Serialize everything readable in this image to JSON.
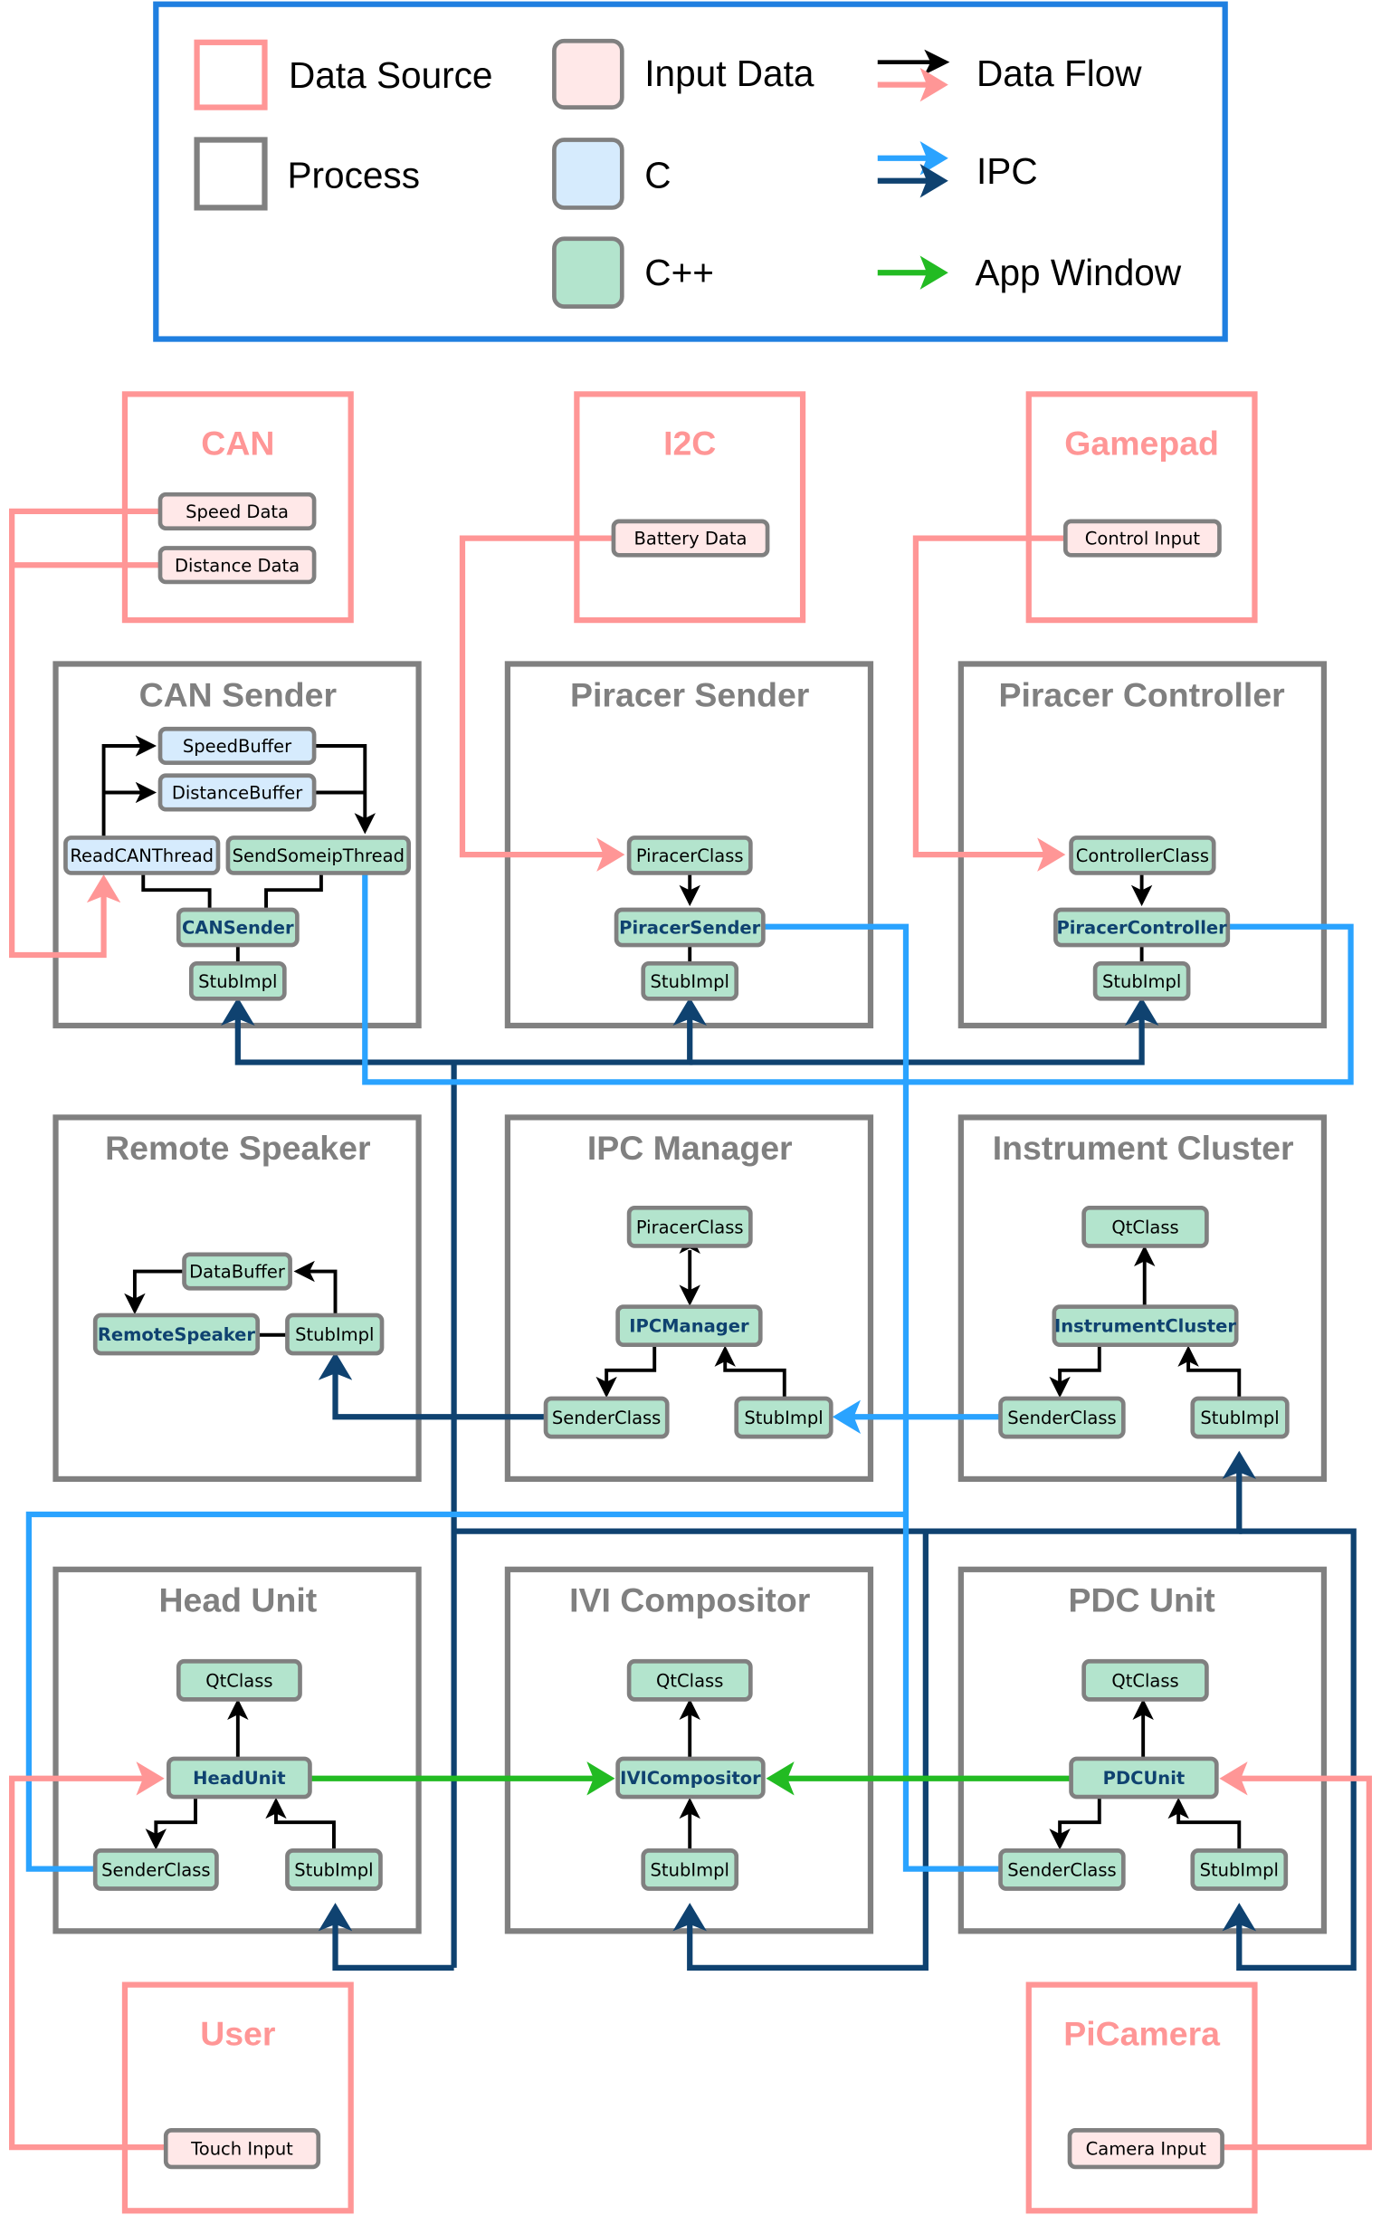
{
  "colors": {
    "data_source": "#ff9696",
    "process": "#808080",
    "input_data_fill": "#ffe8e8",
    "c_fill": "#d6ebfd",
    "cpp_fill": "#b3e4cd",
    "node_border": "#808080",
    "data_flow": "#000000",
    "data_flow_source": "#ff9696",
    "ipc_light": "#2aa3ff",
    "ipc_dark": "#0f4270",
    "app_window": "#22bb22",
    "legend_border": "#1f7fe0",
    "main_node_text": "#0f4270"
  },
  "legend": {
    "data_source": "Data Source",
    "process": "Process",
    "input_data": "Input Data",
    "c": "C",
    "cpp": "C++",
    "data_flow": "Data Flow",
    "ipc": "IPC",
    "app_window": "App Window"
  },
  "sources": {
    "can": {
      "title": "CAN",
      "inputs": [
        "Speed Data",
        "Distance Data"
      ]
    },
    "i2c": {
      "title": "I2C",
      "inputs": [
        "Battery Data"
      ]
    },
    "gamepad": {
      "title": "Gamepad",
      "inputs": [
        "Control Input"
      ]
    },
    "user": {
      "title": "User",
      "inputs": [
        "Touch Input"
      ]
    },
    "picamera": {
      "title": "PiCamera",
      "inputs": [
        "Camera Input"
      ]
    }
  },
  "processes": {
    "can_sender": {
      "title": "CAN Sender",
      "nodes": {
        "speed_buffer": "SpeedBuffer",
        "distance_buffer": "DistanceBuffer",
        "read_can_thread": "ReadCANThread",
        "send_someip_thread": "SendSomeipThread",
        "main": "CANSender",
        "stub": "StubImpl"
      }
    },
    "piracer_sender": {
      "title": "Piracer Sender",
      "nodes": {
        "piracer_class": "PiracerClass",
        "main": "PiracerSender",
        "stub": "StubImpl"
      }
    },
    "piracer_controller": {
      "title": "Piracer Controller",
      "nodes": {
        "controller_class": "ControllerClass",
        "main": "PiracerController",
        "stub": "StubImpl"
      }
    },
    "remote_speaker": {
      "title": "Remote Speaker",
      "nodes": {
        "data_buffer": "DataBuffer",
        "main": "RemoteSpeaker",
        "stub": "StubImpl"
      }
    },
    "ipc_manager": {
      "title": "IPC Manager",
      "nodes": {
        "piracer_class": "PiracerClass",
        "main": "IPCManager",
        "sender": "SenderClass",
        "stub": "StubImpl"
      }
    },
    "instrument_cluster": {
      "title": "Instrument Cluster",
      "nodes": {
        "qt": "QtClass",
        "main": "InstrumentCluster",
        "sender": "SenderClass",
        "stub": "StubImpl"
      }
    },
    "head_unit": {
      "title": "Head Unit",
      "nodes": {
        "qt": "QtClass",
        "main": "HeadUnit",
        "sender": "SenderClass",
        "stub": "StubImpl"
      }
    },
    "ivi_compositor": {
      "title": "IVI Compositor",
      "nodes": {
        "qt": "QtClass",
        "main": "IVICompositor",
        "stub": "StubImpl"
      }
    },
    "pdc_unit": {
      "title": "PDC Unit",
      "nodes": {
        "qt": "QtClass",
        "main": "PDCUnit",
        "sender": "SenderClass",
        "stub": "StubImpl"
      }
    }
  }
}
